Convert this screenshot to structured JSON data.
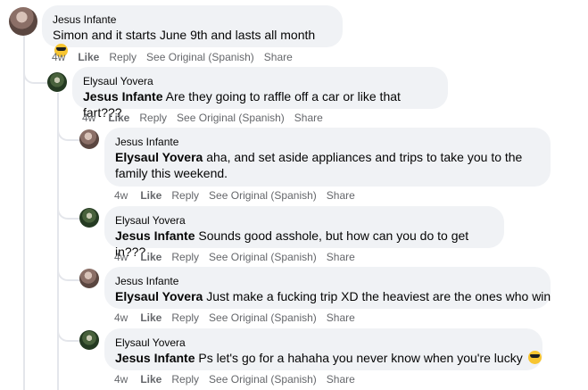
{
  "comments": [
    {
      "author": "Jesus Infante",
      "mention": "",
      "text": "Simon and it starts June 9th and lasts all month",
      "emoji": "sunglasses-emoji",
      "time": "4w",
      "like": "Like",
      "reply": "Reply",
      "see_original": "See Original (Spanish)",
      "share": "Share"
    },
    {
      "author": "Elysaul Yovera",
      "mention": "Jesus Infante",
      "text": "Are they going to raffle off a car or like that fart???",
      "time": "4w",
      "like": "Like",
      "reply": "Reply",
      "see_original": "See Original (Spanish)",
      "share": "Share"
    },
    {
      "author": "Jesus Infante",
      "mention": "Elysaul Yovera",
      "text": "aha, and set aside appliances and trips to take you to the",
      "text2": "family this weekend.",
      "time": "4w",
      "like": "Like",
      "reply": "Reply",
      "see_original": "See Original (Spanish)",
      "share": "Share"
    },
    {
      "author": "Elysaul Yovera",
      "mention": "Jesus Infante",
      "text": "Sounds good asshole, but how can you do to get in???",
      "time": "4w",
      "like": "Like",
      "reply": "Reply",
      "see_original": "See Original (Spanish)",
      "share": "Share"
    },
    {
      "author": "Jesus Infante",
      "mention": "Elysaul Yovera",
      "text": "Just make a fucking trip XD the heaviest are the ones who win",
      "time": "4w",
      "like": "Like",
      "reply": "Reply",
      "see_original": "See Original (Spanish)",
      "share": "Share"
    },
    {
      "author": "Elysaul Yovera",
      "mention": "Jesus Infante",
      "text": "Ps let's go for a hahaha you never know when you're lucky",
      "emoji": "sunglasses-emoji",
      "time": "4w",
      "like": "Like",
      "reply": "Reply",
      "see_original": "See Original (Spanish)",
      "share": "Share"
    }
  ]
}
